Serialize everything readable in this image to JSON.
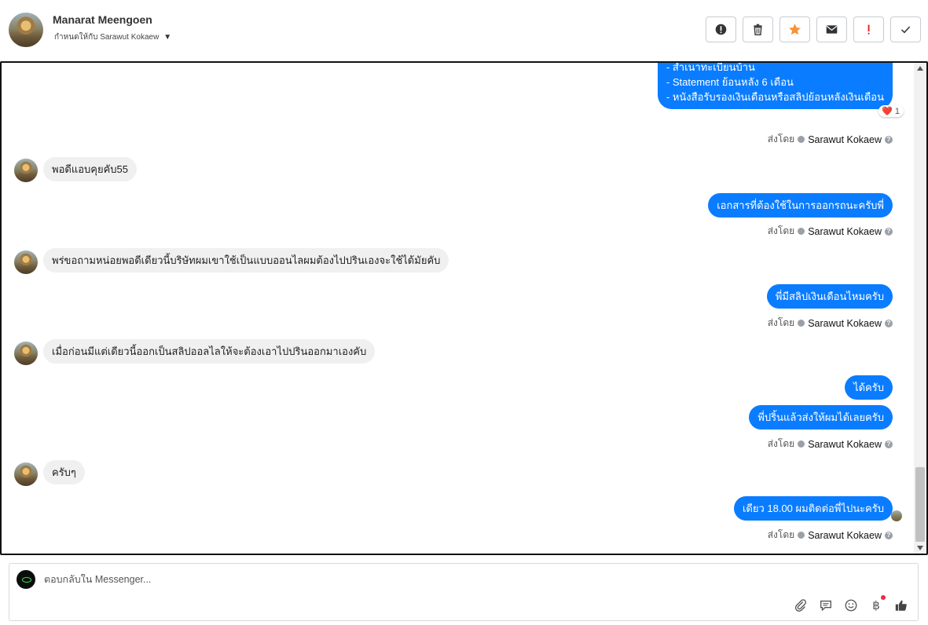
{
  "header": {
    "contact_name": "Manarat Meengoen",
    "assigned_label": "กำหนดให้กับ Sarawut Kokaew",
    "actions": [
      {
        "name": "report-icon",
        "color": "#333333"
      },
      {
        "name": "trash-icon",
        "color": "#333333"
      },
      {
        "name": "star-icon",
        "color": "#f7923a"
      },
      {
        "name": "envelope-icon",
        "color": "#333333"
      },
      {
        "name": "priority-icon",
        "color": "#e02020"
      },
      {
        "name": "check-icon",
        "color": "#333333"
      }
    ]
  },
  "conversation": {
    "list_message_lines": [
      "- สำเนาทะเบียนบ้าน",
      "- Statement ย้อนหลัง 6 เดือน",
      "- หนังสือรับรองเงินเดือนหรือสลิปย้อนหลังเงินเดือน"
    ],
    "reaction": {
      "emoji": "❤️",
      "count": "1"
    },
    "sent_by_prefix": "ส่งโดย",
    "sent_by_name": "Sarawut Kokaew",
    "incoming": [
      "พอดีแอบคุยคับ55",
      "พร่ขอถามหน่อยพอดีเดียวนี้บริษัทผมเขาใช้เป็นแบบออนไลผมต้องไปปรินเองจะใช้ได้มัยคับ",
      "เมื่อก่อนมีแต่เดียวนี้ออกเป็นสลิปออลไลให้จะต้องเอาไปปรินออกมาเองคับ",
      "ครับๆ"
    ],
    "outgoing": [
      "เอกสารที่ต้องใช้ในการออกรถนะครับพี่",
      "พี่มีสลิปเงินเดือนไหมครับ",
      "ได้ครับ",
      "พี่ปริ้นแล้วส่งให้ผมได้เลยครับ",
      "เดียว 18.00 ผมติดต่อพี่ไปนะครับ"
    ],
    "accent_color": "#0a7cff"
  },
  "composer": {
    "placeholder": "ตอบกลับใน Messenger...",
    "tools": [
      "attachment-icon",
      "saved-reply-icon",
      "emoji-icon",
      "baht-icon",
      "like-icon"
    ],
    "baht_symbol": "฿"
  }
}
